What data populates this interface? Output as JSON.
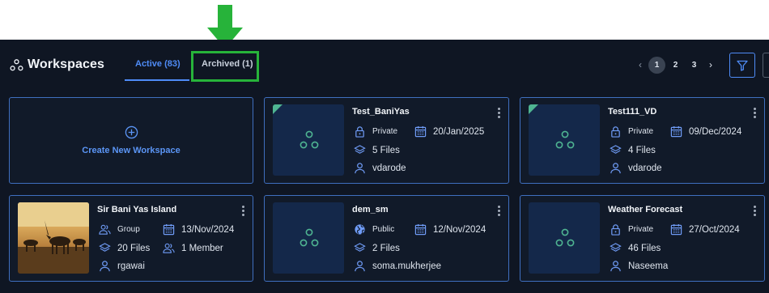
{
  "header": {
    "title": "Workspaces",
    "tabs": [
      {
        "label": "Active (83)",
        "active": true
      },
      {
        "label": "Archived (1)",
        "active": false
      }
    ],
    "pagination": {
      "pages": [
        "1",
        "2",
        "3"
      ],
      "current": "1"
    },
    "accent_color": "#4f8cf7",
    "highlight_color": "#27b33a"
  },
  "create_card": {
    "label": "Create New Workspace"
  },
  "workspaces": [
    {
      "name": "Test_BaniYas",
      "visibility": "Private",
      "date": "20/Jan/2025",
      "files": "5 Files",
      "owner": "vdarode"
    },
    {
      "name": "Test111_VD",
      "visibility": "Private",
      "date": "09/Dec/2024",
      "files": "4 Files",
      "owner": "vdarode"
    },
    {
      "name": "Sir Bani Yas Island",
      "visibility": "Group",
      "date": "13/Nov/2024",
      "files": "20 Files",
      "members": "1 Member",
      "owner": "rgawai"
    },
    {
      "name": "dem_sm",
      "visibility": "Public",
      "date": "12/Nov/2024",
      "files": "2 Files",
      "owner": "soma.mukherjee"
    },
    {
      "name": "Weather Forecast",
      "visibility": "Private",
      "date": "27/Oct/2024",
      "files": "46 Files",
      "owner": "Naseema"
    }
  ]
}
